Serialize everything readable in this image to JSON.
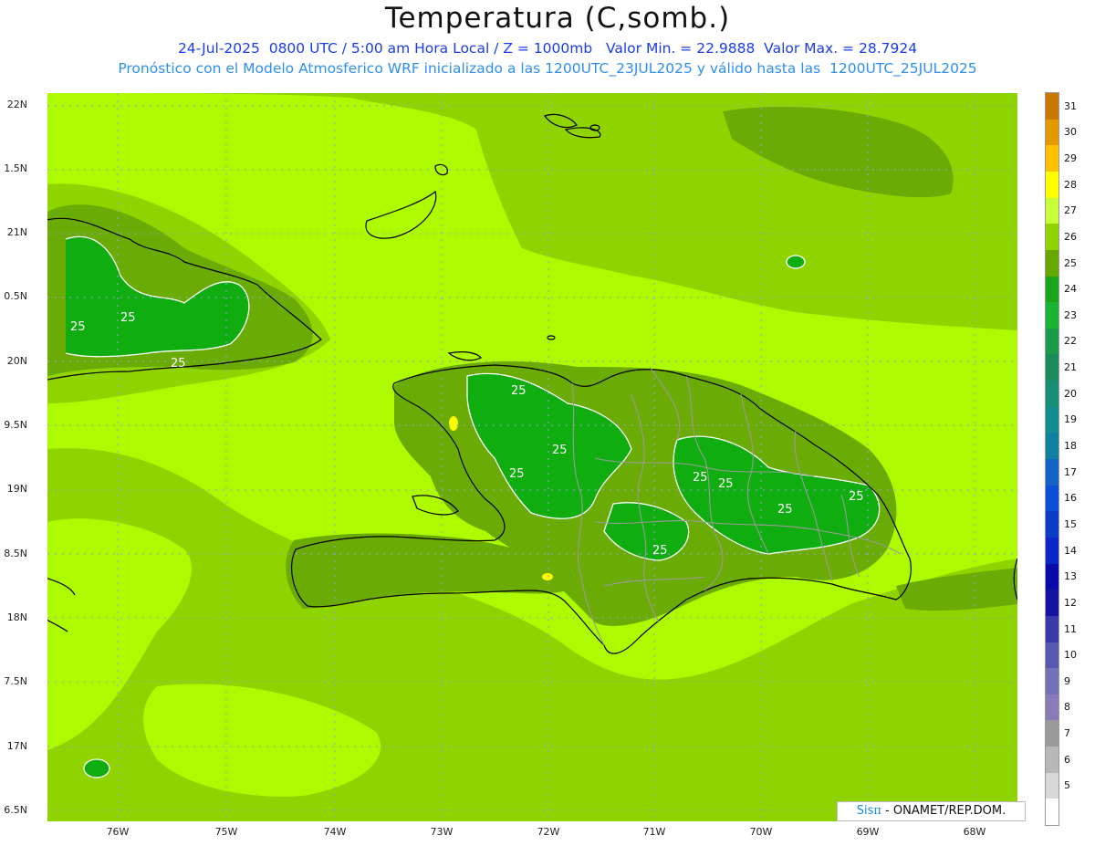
{
  "title": "Temperatura (C,somb.)",
  "subtitle_line1": "24-Jul-2025  0800 UTC / 5:00 am Hora Local / Z = 1000mb   Valor Min. = 22.9888  Valor Max. = 28.7924",
  "subtitle_line2": "Pronóstico con el Modelo Atmosferico WRF inicializado a las 1200UTC_23JUL2025 y válido hasta las  1200UTC_25JUL2025",
  "map": {
    "lat_labels": [
      "22N",
      "1.5N",
      "21N",
      "0.5N",
      "20N",
      "9.5N",
      "19N",
      "8.5N",
      "18N",
      "7.5N",
      "17N",
      "6.5N"
    ],
    "lon_labels": [
      "76W",
      "75W",
      "74W",
      "73W",
      "72W",
      "71W",
      "70W",
      "69W",
      "68W"
    ],
    "contour_label": "25",
    "fill_colors": {
      "c24": "#10ad10",
      "c25": "#6aab05",
      "c26": "#8fd400",
      "c27": "#aefa00"
    }
  },
  "colorbar": {
    "levels": [
      "31",
      "30",
      "29",
      "28",
      "27",
      "26",
      "25",
      "24",
      "23",
      "22",
      "21",
      "20",
      "19",
      "18",
      "17",
      "16",
      "15",
      "14",
      "13",
      "12",
      "11",
      "10",
      "9",
      "8",
      "7",
      "6",
      "5"
    ],
    "colors": [
      "#c77800",
      "#e19b00",
      "#ffc000",
      "#ffff00",
      "#c8fe39",
      "#90d300",
      "#66a800",
      "#1aa61a",
      "#19b432",
      "#1a9b4a",
      "#1a8b5a",
      "#178f76",
      "#118c8f",
      "#1080a0",
      "#1464c8",
      "#0d4fd8",
      "#0a3cc8",
      "#0a28c8",
      "#0a0aa8",
      "#1414a0",
      "#3a3aa8",
      "#5858b0",
      "#7272b8",
      "#8a7aba",
      "#9a9a9a",
      "#b8b8b8",
      "#d8d8d8",
      "#ffffff"
    ]
  },
  "credit": {
    "brand": "Sis",
    "pi": "π",
    "rest": " - ONAMET/REP.DOM."
  }
}
